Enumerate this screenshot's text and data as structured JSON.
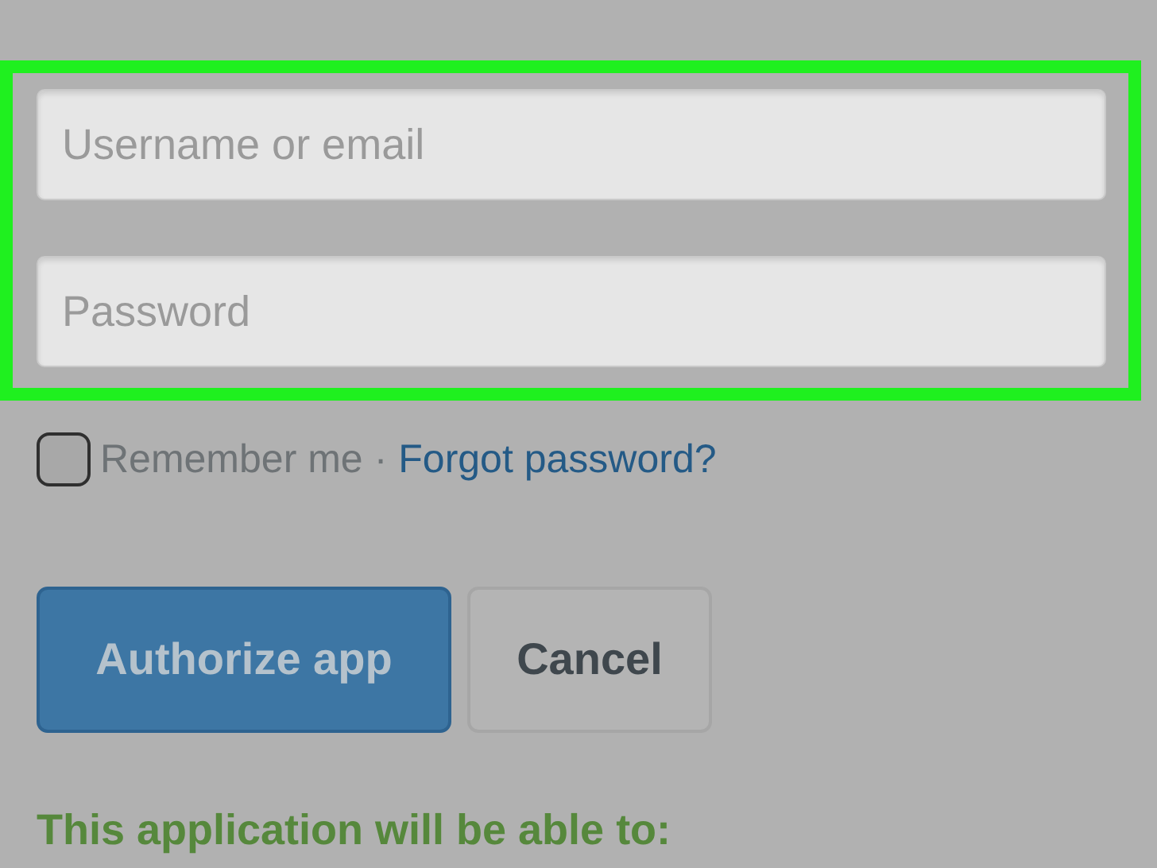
{
  "login_form": {
    "highlighted": true,
    "fields": [
      {
        "placeholder": "Username or email"
      },
      {
        "placeholder": "Password"
      }
    ]
  },
  "remember": {
    "label": "Remember me",
    "checked": false
  },
  "separator": "·",
  "forgot_link": "Forgot password?",
  "buttons": [
    {
      "label": "Authorize app",
      "kind": "primary"
    },
    {
      "label": "Cancel",
      "kind": "secondary"
    }
  ],
  "permissions_heading": "This application will be able to:"
}
